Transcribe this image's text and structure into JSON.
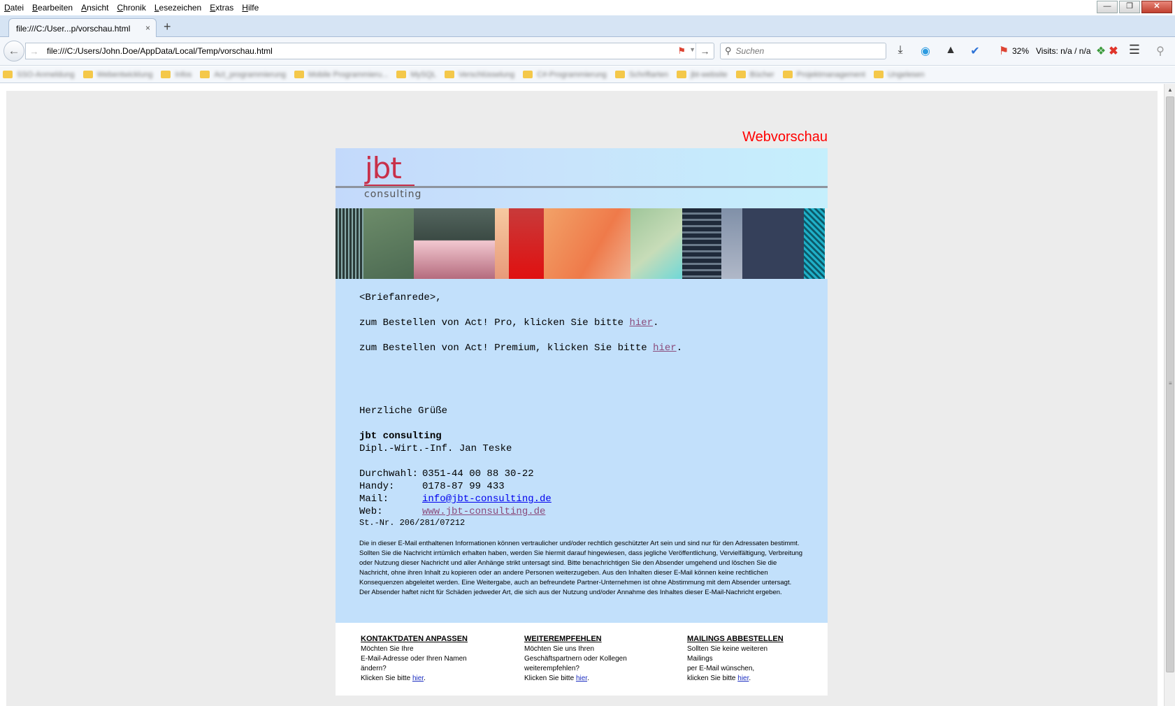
{
  "menubar": {
    "items": [
      "Datei",
      "Bearbeiten",
      "Ansicht",
      "Chronik",
      "Lesezeichen",
      "Extras",
      "Hilfe"
    ]
  },
  "tabs": [
    {
      "label": "file:///C:/User...p/vorschau.html",
      "close": "×"
    }
  ],
  "newtab_label": "+",
  "navbar": {
    "url": "file:///C:/Users/John.Doe/AppData/Local/Temp/vorschau.html",
    "search_placeholder": "Suchen",
    "zoom_text": "32%",
    "visits_text": "Visits: n/a / n/a"
  },
  "bookmarks": [
    "SSO-Anmeldung",
    "Webentwicklung",
    "Infos",
    "Act_programmierung",
    "Mobile Programmieru...",
    "MySQL",
    "Verschlüsselung",
    "C#-Programmierung",
    "Schriftarten",
    "jbt-website",
    "Bücher",
    "Projektmanagement",
    "Ungelesen"
  ],
  "email": {
    "webvorschau": "Webvorschau",
    "logo_main": "jbt",
    "logo_sub": "consulting",
    "salutation": "<Briefanrede>,",
    "line1_prefix": "zum Bestellen von Act! Pro, klicken Sie bitte ",
    "line1_link": "hier",
    "line1_suffix": ".",
    "line2_prefix": "zum Bestellen von Act! Premium, klicken Sie bitte ",
    "line2_link": "hier",
    "line2_suffix": ".",
    "greeting": "Herzliche Grüße",
    "company": "jbt consulting",
    "person": "Dipl.-Wirt.-Inf. Jan Teske",
    "contacts": [
      {
        "key": "Durchwahl:",
        "value": "0351-44 00 88 30-22"
      },
      {
        "key": "Handy:",
        "value": "0178-87 99 433"
      },
      {
        "key": "Mail:",
        "value": "info@jbt-consulting.de"
      },
      {
        "key": "Web:",
        "value": "www.jbt-consulting.de"
      }
    ],
    "taxnr": "St.-Nr. 206/281/07212",
    "disclaimer": "Die in dieser E-Mail enthaltenen Informationen können vertraulicher und/oder rechtlich geschützter Art sein und sind nur für den Adressaten bestimmt. Sollten Sie die Nachricht irrtümlich erhalten haben, werden Sie hiermit darauf hingewiesen, dass jegliche Veröffentlichung, Vervielfältigung, Verbreitung oder Nutzung dieser Nachricht und aller Anhänge strikt untersagt sind. Bitte benachrichtigen Sie den Absender umgehend und löschen Sie die Nachricht, ohne ihren Inhalt zu kopieren oder an andere Personen weiterzugeben. Aus den Inhalten dieser E-Mail können keine rechtlichen Konsequenzen abgeleitet werden. Eine Weitergabe, auch an befreundete Partner-Unternehmen ist ohne Abstimmung mit dem Absender untersagt. Der Absender haftet nicht für Schäden jedweder Art, die sich aus der Nutzung und/oder Annahme des Inhaltes dieser E-Mail-Nachricht ergeben.",
    "footer": [
      {
        "title": "KONTAKTDATEN ANPASSEN",
        "lines": [
          "Möchten Sie Ihre",
          "E-Mail-Adresse oder Ihren Namen",
          "ändern?"
        ],
        "cta_prefix": "Klicken Sie bitte ",
        "cta_link": "hier",
        "cta_suffix": "."
      },
      {
        "title": "WEITEREMPFEHLEN",
        "lines": [
          "Möchten Sie uns Ihren",
          "Geschäftspartnern oder Kollegen",
          "weiterempfehlen?"
        ],
        "cta_prefix": "Klicken Sie bitte ",
        "cta_link": "hier",
        "cta_suffix": "."
      },
      {
        "title": "MAILINGS ABBESTELLEN",
        "lines": [
          "Sollten Sie keine weiteren",
          "Mailings",
          "per E-Mail wünschen,"
        ],
        "cta_prefix": "klicken Sie bitte ",
        "cta_link": "hier",
        "cta_suffix": "."
      }
    ]
  },
  "colors": {
    "accent_red": "#ff0000",
    "logo_red": "#c8304a",
    "email_body_bg": "#c2e0fb",
    "link_purple": "#8a4a7a",
    "link_blue": "#0000ee"
  }
}
